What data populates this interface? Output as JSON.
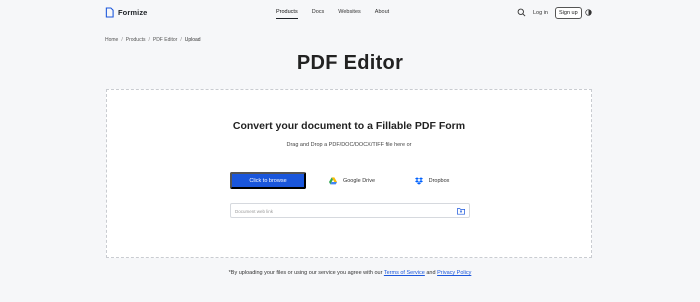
{
  "header": {
    "brand": "Formize",
    "nav": [
      "Products",
      "Docs",
      "Websites",
      "About"
    ],
    "active_nav": "Products",
    "login_label": "Log in",
    "signup_label": "Sign up"
  },
  "breadcrumb": {
    "items": [
      "Home",
      "Products",
      "PDF Editor",
      "Upload"
    ],
    "separator": "/"
  },
  "page_title": "PDF Editor",
  "upload": {
    "heading": "Convert your document to a Fillable PDF Form",
    "subtext": "Drag and Drop a PDF/DOC/DOCX/TIFF file here or",
    "browse_label": "Click to browse",
    "gdrive_label": "Google Drive",
    "dropbox_label": "Dropbox",
    "url_placeholder": "Document web link"
  },
  "footer": {
    "prefix": "*By uploading your files or using our service you agree with our",
    "tos_label": "Terms of Service",
    "and": "and",
    "privacy_label": "Privacy Policy"
  },
  "colors": {
    "accent": "#1a56db",
    "page_bg": "#f6f7f9"
  }
}
